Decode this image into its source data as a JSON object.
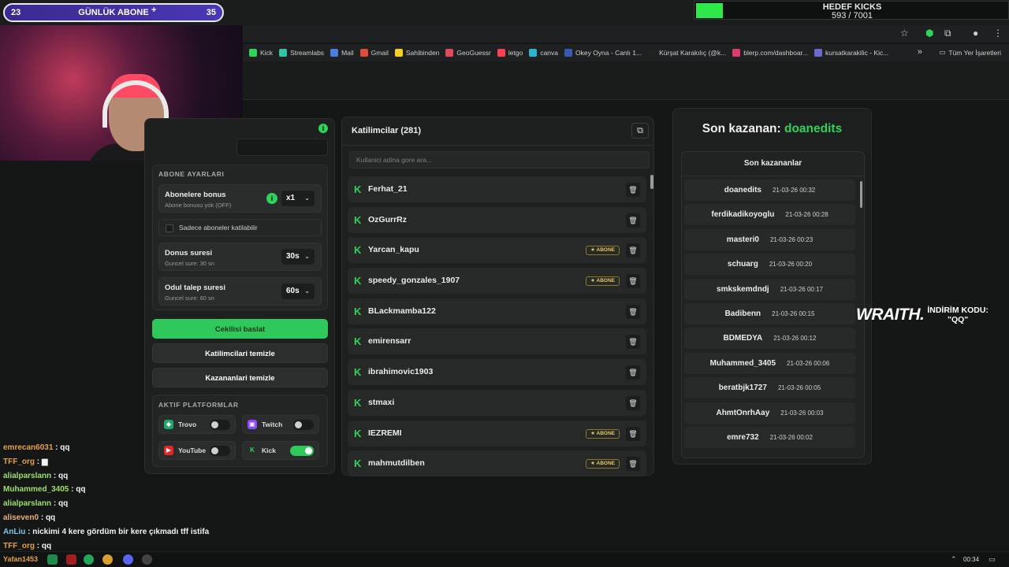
{
  "overlay": {
    "sub_count_left": "23",
    "sub_label": "GÜNLÜK ABONE",
    "sub_plus": "+",
    "sub_count_right": "35",
    "goal_title": "HEDEF KICKS",
    "goal_value": "593 / 7001",
    "goal_progress": 0.085,
    "promo_brand": "WRAITH.",
    "promo_label": "İNDİRİM KODU:",
    "promo_code": "\"QQ\""
  },
  "bookmarks": [
    {
      "label": "Kick",
      "color": "#2fd35a"
    },
    {
      "label": "Streamlabs",
      "color": "#31c3a2"
    },
    {
      "label": "Mail",
      "color": "#4a7fe0"
    },
    {
      "label": "Gmail",
      "color": "#e04a3a"
    },
    {
      "label": "Sahibinden",
      "color": "#f5d020"
    },
    {
      "label": "GeoGuessr",
      "color": "#e04a5a"
    },
    {
      "label": "letgo",
      "color": "#ff3f55"
    },
    {
      "label": "canva",
      "color": "#2ab4d0"
    },
    {
      "label": "Okey Oyna - Canlı 1...",
      "color": "#3a5ab0"
    },
    {
      "label": "Kürşat Karakılıç (@k...",
      "color": "#222222"
    },
    {
      "label": "blerp.com/dashboar...",
      "color": "#e03a6a"
    },
    {
      "label": "kursatkarakilic - Kic...",
      "color": "#6a6ad0"
    }
  ],
  "bookmarks_right": "Tüm Yer İşaretleri",
  "settings": {
    "section_title": "ABONE AYARLARI",
    "bonus_label": "Abonelere bonus",
    "bonus_sub": "Abone bonusu yok (OFF)",
    "bonus_value": "x1",
    "only_subs_label": "Sadece aboneler katilabilir",
    "duration_label": "Donus suresi",
    "duration_sub": "Guncel sure: 30 sn",
    "duration_value": "30s",
    "claim_label": "Odul talep suresi",
    "claim_sub": "Guncel sure: 60 sn",
    "claim_value": "60s",
    "start_button": "Cekilisi baslat",
    "clear_participants": "Katilimcilari temizle",
    "clear_winners": "Kazananlari temizle",
    "platforms_title": "AKTIF PLATFORMLAR",
    "platforms": [
      {
        "name": "Trovo",
        "on": false,
        "color": "#1fa86a"
      },
      {
        "name": "Twitch",
        "on": false,
        "color": "#9146ff"
      },
      {
        "name": "YouTube",
        "on": false,
        "color": "#e02a2a"
      },
      {
        "name": "Kick",
        "on": true,
        "color": "#2fd35a"
      }
    ]
  },
  "participants": {
    "title": "Katilimcilar (281)",
    "search_placeholder": "Kullanici adina gore ara...",
    "badge_label": "★ ABONE",
    "items": [
      {
        "name": "Ferhat_21",
        "sub": false
      },
      {
        "name": "OzGurrRz",
        "sub": false
      },
      {
        "name": "Yarcan_kapu",
        "sub": true
      },
      {
        "name": "speedy_gonzales_1907",
        "sub": true
      },
      {
        "name": "BLackmamba122",
        "sub": false
      },
      {
        "name": "emirensarr",
        "sub": false
      },
      {
        "name": "ibrahimovic1903",
        "sub": false
      },
      {
        "name": "stmaxi",
        "sub": false
      },
      {
        "name": "IEZREMI",
        "sub": true
      },
      {
        "name": "mahmutdilben",
        "sub": true
      }
    ]
  },
  "winners": {
    "title_prefix": "Son kazanan: ",
    "last_winner": "doanedits",
    "list_title": "Son kazananlar",
    "items": [
      {
        "name": "doanedits",
        "time": "21-03-26 00:32"
      },
      {
        "name": "ferdikadikoyoglu",
        "time": "21-03-26 00:28"
      },
      {
        "name": "masteri0",
        "time": "21-03-26 00:23"
      },
      {
        "name": "schuarg",
        "time": "21-03-26 00:20"
      },
      {
        "name": "smkskemdndj",
        "time": "21-03-26 00:17"
      },
      {
        "name": "Badibenn",
        "time": "21-03-26 00:15"
      },
      {
        "name": "BDMEDYA",
        "time": "21-03-26 00:12"
      },
      {
        "name": "Muhammed_3405",
        "time": "21-03-26 00:06"
      },
      {
        "name": "beratbjk1727",
        "time": "21-03-26 00:05"
      },
      {
        "name": "AhmtOnrhAay",
        "time": "21-03-26 00:03"
      },
      {
        "name": "emre732",
        "time": "21-03-26 00:02"
      }
    ]
  },
  "chat": [
    {
      "user": "emrecan6031",
      "msg": "qq",
      "cls": "u"
    },
    {
      "user": "TFF_org",
      "msg": "▆",
      "cls": "u"
    },
    {
      "user": "alialparslann",
      "msg": "qq",
      "cls": "u3"
    },
    {
      "user": "Muhammed_3405",
      "msg": "qq",
      "cls": "u3"
    },
    {
      "user": "alialparslann",
      "msg": "qq",
      "cls": "u3"
    },
    {
      "user": "aliseven0",
      "msg": "qq",
      "cls": "u4"
    },
    {
      "user": "AnLiu",
      "msg": "nickimi 4 kere gördüm bir kere çıkmadı tff istifa",
      "cls": "u2"
    },
    {
      "user": "TFF_org",
      "msg": "qq",
      "cls": "u"
    }
  ],
  "taskbar": {
    "clock": "00:34",
    "chat_user_fragment": "Yafan1453"
  }
}
